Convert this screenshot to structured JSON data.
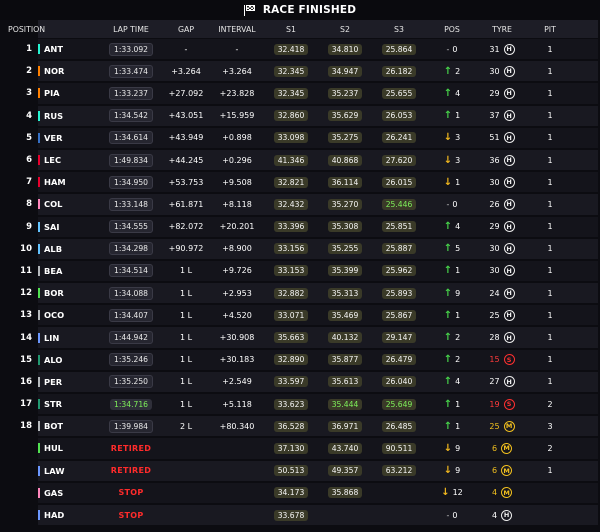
{
  "title": "RACE FINISHED",
  "headers": {
    "position": "POSITION",
    "lap_time": "LAP TIME",
    "gap": "GAP",
    "interval": "INTERVAL",
    "s1": "S1",
    "s2": "S2",
    "s3": "S3",
    "pos": "POS",
    "tyre": "TYRE",
    "pit": "PIT"
  },
  "team_colors": {
    "mercedes": "#27f4d2",
    "rb": "#6c98ff",
    "mclaren": "#ff8000",
    "ferrari": "#e8002d",
    "redbull": "#3671c6",
    "haas": "#b6babd",
    "alpine": "#ff87bc",
    "williams": "#64c4ff",
    "sauber": "#52e252",
    "aston": "#229971"
  },
  "drivers": [
    {
      "num": "1",
      "code": "ANT",
      "team": "mercedes",
      "lap": "1:33.092",
      "lap_style": "lap",
      "gap": "-",
      "interval": "-",
      "s1": "32.418",
      "s1_style": "white",
      "s2": "34.810",
      "s2_style": "white",
      "s3": "25.864",
      "s3_style": "white",
      "chg_dir": "none",
      "chg": "0",
      "tyre": "H",
      "age": "31",
      "age_style": "",
      "pit": "1"
    },
    {
      "num": "2",
      "code": "NOR",
      "team": "mclaren",
      "lap": "1:33.474",
      "lap_style": "lap",
      "gap": "+3.264",
      "interval": "+3.264",
      "s1": "32.345",
      "s1_style": "white",
      "s2": "34.947",
      "s2_style": "white",
      "s3": "26.182",
      "s3_style": "white",
      "chg_dir": "up",
      "chg": "2",
      "tyre": "H",
      "age": "30",
      "age_style": "",
      "pit": "1"
    },
    {
      "num": "3",
      "code": "PIA",
      "team": "mclaren",
      "lap": "1:33.237",
      "lap_style": "lap",
      "gap": "+27.092",
      "interval": "+23.828",
      "s1": "32.345",
      "s1_style": "white",
      "s2": "35.237",
      "s2_style": "white",
      "s3": "25.655",
      "s3_style": "white",
      "chg_dir": "up",
      "chg": "4",
      "tyre": "H",
      "age": "29",
      "age_style": "",
      "pit": "1"
    },
    {
      "num": "4",
      "code": "RUS",
      "team": "mercedes",
      "lap": "1:34.542",
      "lap_style": "lap",
      "gap": "+43.051",
      "interval": "+15.959",
      "s1": "32.860",
      "s1_style": "white",
      "s2": "35.629",
      "s2_style": "white",
      "s3": "26.053",
      "s3_style": "white",
      "chg_dir": "up",
      "chg": "1",
      "tyre": "H",
      "age": "37",
      "age_style": "",
      "pit": "1"
    },
    {
      "num": "5",
      "code": "VER",
      "team": "redbull",
      "lap": "1:34.614",
      "lap_style": "lap",
      "gap": "+43.949",
      "interval": "+0.898",
      "s1": "33.098",
      "s1_style": "white",
      "s2": "35.275",
      "s2_style": "white",
      "s3": "26.241",
      "s3_style": "white",
      "chg_dir": "down",
      "chg": "3",
      "tyre": "H",
      "age": "51",
      "age_style": "",
      "pit": "1"
    },
    {
      "num": "6",
      "code": "LEC",
      "team": "ferrari",
      "lap": "1:49.834",
      "lap_style": "lap",
      "gap": "+44.245",
      "interval": "+0.296",
      "s1": "41.346",
      "s1_style": "white",
      "s2": "40.868",
      "s2_style": "white",
      "s3": "27.620",
      "s3_style": "white",
      "chg_dir": "down",
      "chg": "3",
      "tyre": "H",
      "age": "36",
      "age_style": "",
      "pit": "1"
    },
    {
      "num": "7",
      "code": "HAM",
      "team": "ferrari",
      "lap": "1:34.950",
      "lap_style": "lap",
      "gap": "+53.753",
      "interval": "+9.508",
      "s1": "32.821",
      "s1_style": "white",
      "s2": "36.114",
      "s2_style": "white",
      "s3": "26.015",
      "s3_style": "white",
      "chg_dir": "down",
      "chg": "1",
      "tyre": "H",
      "age": "30",
      "age_style": "",
      "pit": "1"
    },
    {
      "num": "8",
      "code": "COL",
      "team": "alpine",
      "lap": "1:33.148",
      "lap_style": "lap",
      "gap": "+61.871",
      "interval": "+8.118",
      "s1": "32.432",
      "s1_style": "white",
      "s2": "35.270",
      "s2_style": "white",
      "s3": "25.446",
      "s3_style": "green",
      "chg_dir": "none",
      "chg": "0",
      "tyre": "H",
      "age": "26",
      "age_style": "",
      "pit": "1"
    },
    {
      "num": "9",
      "code": "SAI",
      "team": "williams",
      "lap": "1:34.555",
      "lap_style": "lap",
      "gap": "+82.072",
      "interval": "+20.201",
      "s1": "33.396",
      "s1_style": "white",
      "s2": "35.308",
      "s2_style": "white",
      "s3": "25.851",
      "s3_style": "white",
      "chg_dir": "up",
      "chg": "4",
      "tyre": "H",
      "age": "29",
      "age_style": "",
      "pit": "1"
    },
    {
      "num": "10",
      "code": "ALB",
      "team": "williams",
      "lap": "1:34.298",
      "lap_style": "lap",
      "gap": "+90.972",
      "interval": "+8.900",
      "s1": "33.156",
      "s1_style": "white",
      "s2": "35.255",
      "s2_style": "white",
      "s3": "25.887",
      "s3_style": "white",
      "chg_dir": "up",
      "chg": "5",
      "tyre": "H",
      "age": "30",
      "age_style": "",
      "pit": "1"
    },
    {
      "num": "11",
      "code": "BEA",
      "team": "haas",
      "lap": "1:34.514",
      "lap_style": "lap",
      "gap": "1 L",
      "interval": "+9.726",
      "s1": "33.153",
      "s1_style": "white",
      "s2": "35.399",
      "s2_style": "white",
      "s3": "25.962",
      "s3_style": "white",
      "chg_dir": "up",
      "chg": "1",
      "tyre": "H",
      "age": "30",
      "age_style": "",
      "pit": "1"
    },
    {
      "num": "12",
      "code": "BOR",
      "team": "sauber",
      "lap": "1:34.088",
      "lap_style": "lap",
      "gap": "1 L",
      "interval": "+2.953",
      "s1": "32.882",
      "s1_style": "white",
      "s2": "35.313",
      "s2_style": "white",
      "s3": "25.893",
      "s3_style": "white",
      "chg_dir": "up",
      "chg": "9",
      "tyre": "H",
      "age": "24",
      "age_style": "",
      "pit": "1"
    },
    {
      "num": "13",
      "code": "OCO",
      "team": "haas",
      "lap": "1:34.407",
      "lap_style": "lap",
      "gap": "1 L",
      "interval": "+4.520",
      "s1": "33.071",
      "s1_style": "white",
      "s2": "35.469",
      "s2_style": "white",
      "s3": "25.867",
      "s3_style": "white",
      "chg_dir": "up",
      "chg": "1",
      "tyre": "H",
      "age": "25",
      "age_style": "",
      "pit": "1"
    },
    {
      "num": "14",
      "code": "LIN",
      "team": "rb",
      "lap": "1:44.942",
      "lap_style": "lap",
      "gap": "1 L",
      "interval": "+30.908",
      "s1": "35.663",
      "s1_style": "white",
      "s2": "40.132",
      "s2_style": "white",
      "s3": "29.147",
      "s3_style": "white",
      "chg_dir": "up",
      "chg": "2",
      "tyre": "H",
      "age": "28",
      "age_style": "",
      "pit": "1"
    },
    {
      "num": "15",
      "code": "ALO",
      "team": "aston",
      "lap": "1:35.246",
      "lap_style": "lap",
      "gap": "1 L",
      "interval": "+30.183",
      "s1": "32.890",
      "s1_style": "white",
      "s2": "35.877",
      "s2_style": "white",
      "s3": "26.479",
      "s3_style": "white",
      "chg_dir": "up",
      "chg": "2",
      "tyre": "S",
      "age": "15",
      "age_style": "red",
      "pit": "1"
    },
    {
      "num": "16",
      "code": "PER",
      "team": "haas",
      "lap": "1:35.250",
      "lap_style": "lap",
      "gap": "1 L",
      "interval": "+2.549",
      "s1": "33.597",
      "s1_style": "white",
      "s2": "35.613",
      "s2_style": "white",
      "s3": "26.040",
      "s3_style": "white",
      "chg_dir": "up",
      "chg": "4",
      "tyre": "H",
      "age": "27",
      "age_style": "",
      "pit": "1"
    },
    {
      "num": "17",
      "code": "STR",
      "team": "aston",
      "lap": "1:34.716",
      "lap_style": "purple",
      "gap": "1 L",
      "interval": "+5.118",
      "s1": "33.623",
      "s1_style": "white",
      "s2": "35.444",
      "s2_style": "green",
      "s3": "25.649",
      "s3_style": "green",
      "chg_dir": "up",
      "chg": "1",
      "tyre": "S",
      "age": "19",
      "age_style": "red",
      "pit": "2"
    },
    {
      "num": "18",
      "code": "BOT",
      "team": "haas",
      "lap": "1:39.984",
      "lap_style": "lap",
      "gap": "2 L",
      "interval": "+80.340",
      "s1": "36.528",
      "s1_style": "white",
      "s2": "36.971",
      "s2_style": "white",
      "s3": "26.485",
      "s3_style": "white",
      "chg_dir": "up",
      "chg": "1",
      "tyre": "M",
      "age": "25",
      "age_style": "yel",
      "pit": "3"
    },
    {
      "num": "",
      "code": "HUL",
      "team": "sauber",
      "lap": "RETIRED",
      "lap_style": "status",
      "gap": "",
      "interval": "",
      "s1": "37.130",
      "s1_style": "white",
      "s2": "43.740",
      "s2_style": "white",
      "s3": "90.511",
      "s3_style": "white",
      "chg_dir": "down",
      "chg": "9",
      "tyre": "M",
      "age": "6",
      "age_style": "yel",
      "pit": "2"
    },
    {
      "num": "",
      "code": "LAW",
      "team": "rb",
      "lap": "RETIRED",
      "lap_style": "status",
      "gap": "",
      "interval": "",
      "s1": "50.513",
      "s1_style": "white",
      "s2": "49.357",
      "s2_style": "white",
      "s3": "63.212",
      "s3_style": "white",
      "chg_dir": "down",
      "chg": "9",
      "tyre": "M",
      "age": "6",
      "age_style": "yel",
      "pit": "1"
    },
    {
      "num": "",
      "code": "GAS",
      "team": "alpine",
      "lap": "STOP",
      "lap_style": "status",
      "gap": "",
      "interval": "",
      "s1": "34.173",
      "s1_style": "white",
      "s2": "35.868",
      "s2_style": "white",
      "s3": "",
      "s3_style": "white",
      "chg_dir": "down",
      "chg": "12",
      "tyre": "M",
      "age": "4",
      "age_style": "yel",
      "pit": ""
    },
    {
      "num": "",
      "code": "HAD",
      "team": "rb",
      "lap": "STOP",
      "lap_style": "status",
      "gap": "",
      "interval": "",
      "s1": "33.678",
      "s1_style": "white",
      "s2": "",
      "s2_style": "white",
      "s3": "",
      "s3_style": "white",
      "chg_dir": "none",
      "chg": "0",
      "tyre": "H",
      "age": "4",
      "age_style": "",
      "pit": ""
    }
  ]
}
